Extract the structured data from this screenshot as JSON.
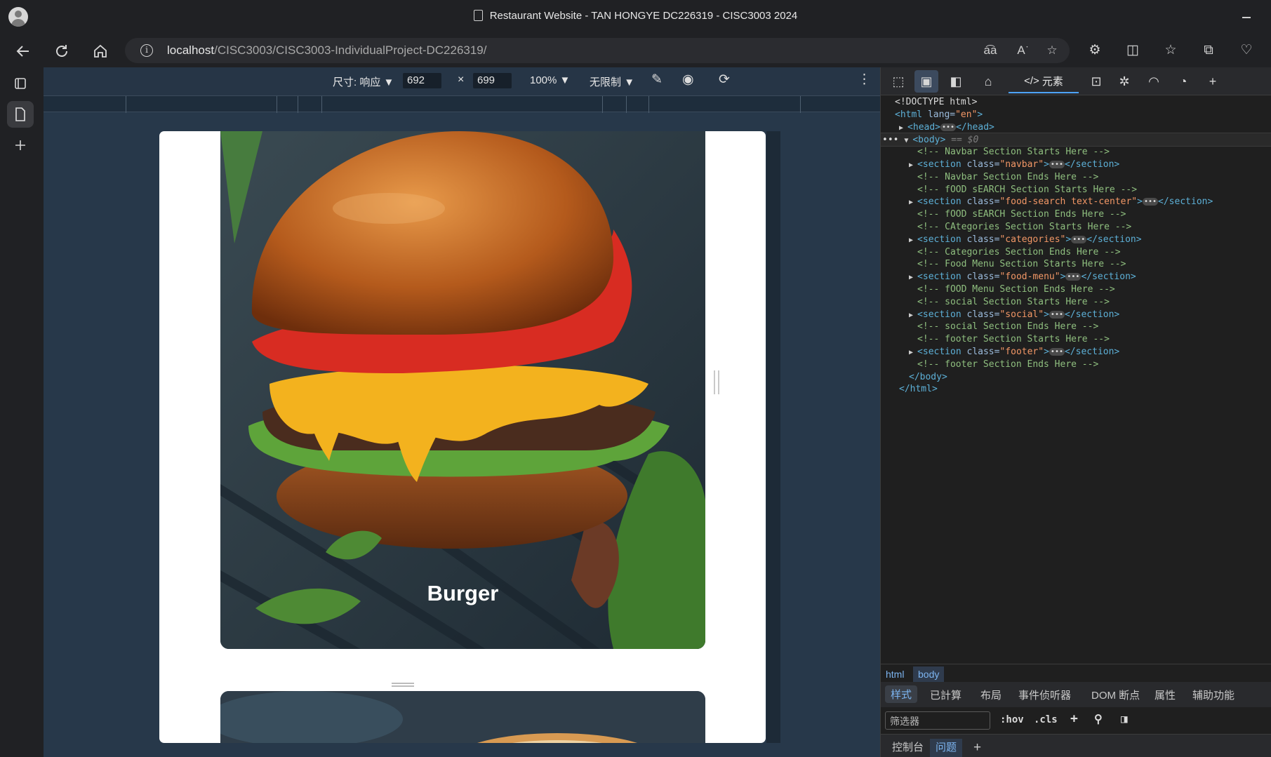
{
  "window": {
    "title": "Restaurant Website - TAN HONGYE DC226319 - CISC3003 2024"
  },
  "address_bar": {
    "host": "localhost",
    "path": "/CISC3003/CISC3003-IndividualProject-DC226319/"
  },
  "emulation": {
    "size_label": "尺寸: 响应",
    "width": "692",
    "x": "×",
    "height": "699",
    "zoom": "100%",
    "throttle": "无限制"
  },
  "page": {
    "card_label": "Burger"
  },
  "devtools": {
    "elements_tab": "元素",
    "dom_lines": [
      {
        "type": "doctype",
        "text": "<!DOCTYPE html>"
      },
      {
        "type": "html",
        "tag": "<html",
        "attr": " lang=",
        "val": "\"en\"",
        "end": ">"
      },
      {
        "type": "head"
      },
      {
        "type": "body",
        "suffix": " == $0"
      },
      {
        "type": "comment",
        "text": "<!-- Navbar Section Starts Here -->"
      },
      {
        "type": "section",
        "cls": "\"navbar\""
      },
      {
        "type": "comment",
        "text": "<!-- Navbar Section Ends Here -->"
      },
      {
        "type": "comment",
        "text": "<!-- fOOD sEARCH Section Starts Here -->"
      },
      {
        "type": "section",
        "cls": "\"food-search text-center\""
      },
      {
        "type": "comment",
        "text": "<!-- fOOD sEARCH Section Ends Here -->"
      },
      {
        "type": "comment",
        "text": "<!-- CAtegories Section Starts Here -->"
      },
      {
        "type": "section",
        "cls": "\"categories\""
      },
      {
        "type": "comment",
        "text": "<!-- Categories Section Ends Here -->"
      },
      {
        "type": "comment",
        "text": "<!-- Food Menu Section Starts Here -->"
      },
      {
        "type": "section",
        "cls": "\"food-menu\""
      },
      {
        "type": "comment",
        "text": "<!-- fOOD Menu Section Ends Here -->"
      },
      {
        "type": "comment",
        "text": "<!-- social Section Starts Here -->"
      },
      {
        "type": "section",
        "cls": "\"social\""
      },
      {
        "type": "comment",
        "text": "<!-- social Section Ends Here -->"
      },
      {
        "type": "comment",
        "text": "<!-- footer Section Starts Here -->"
      },
      {
        "type": "section",
        "cls": "\"footer\""
      },
      {
        "type": "comment",
        "text": "<!-- footer Section Ends Here -->"
      },
      {
        "type": "close",
        "text": "</body>"
      },
      {
        "type": "close2",
        "text": "</html>"
      }
    ],
    "breadcrumbs": [
      "html",
      "body"
    ],
    "styles_tabs": [
      "样式",
      "已計算",
      "布局",
      "事件侦听器",
      "DOM 断点",
      "属性",
      "辅助功能"
    ],
    "filter_placeholder": "筛选器",
    "hov": ":hov",
    "cls": ".cls",
    "drawer_tabs": [
      "控制台",
      "问题"
    ]
  }
}
